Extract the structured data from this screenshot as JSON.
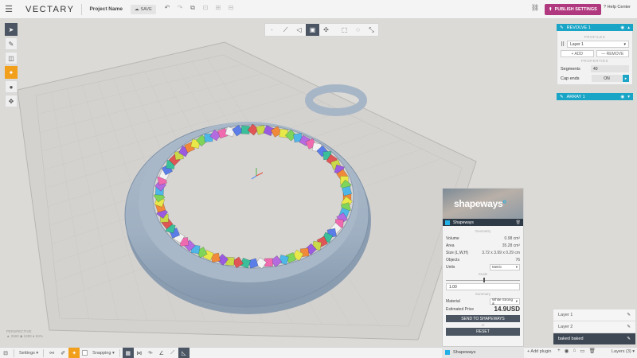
{
  "app": {
    "logo": "VECTARY",
    "project_name": "Project Name",
    "save_label": "SAVE"
  },
  "topbar": {
    "publish_label": "PUBLISH SETTINGS",
    "help_label": "Help Center"
  },
  "revolve_panel": {
    "title": "REVOLVE 1",
    "section_profiles": "PROFILES",
    "layer_value": "Layer 1",
    "add_label": "+ ADD",
    "remove_label": "— REMOVE",
    "section_properties": "PROPERTIES",
    "segments_label": "Segments",
    "segments_value": "40",
    "cap_ends_label": "Cap ends",
    "cap_ends_value": "ON"
  },
  "array_panel": {
    "title": "ARRAY 1"
  },
  "shapeways": {
    "logo": "shapeways",
    "plugin_name": "Shapeways",
    "geometry_label": "Geometry",
    "volume_label": "Volume",
    "volume_value": "0.98 cm²",
    "area_label": "Area",
    "area_value": "35.28 cm²",
    "size_label": "Size (L,W,H)",
    "size_value": "3.72 x 3.99 x 0.29 cm",
    "objects_label": "Objects",
    "objects_value": "76",
    "units_label": "Units",
    "units_value": "Metric",
    "scale_label": "Scale",
    "scale_value": "1.00",
    "summary_label": "Summary",
    "material_label": "Material",
    "material_value": "White Strong &",
    "price_label": "Estimated Price",
    "price_value": "14.9USD",
    "send_label": "SEND TO SHAPEWAYS",
    "or_label": "or",
    "reset_label": "RESET"
  },
  "layers": {
    "items": [
      {
        "label": "Layer 1",
        "selected": false
      },
      {
        "label": "Layer 2",
        "selected": false
      },
      {
        "label": "baked baked",
        "selected": true
      }
    ],
    "layers_button": "Layers (3)"
  },
  "bottombar": {
    "settings_label": "Settings",
    "snapping_label": "Snapping",
    "shapeways_tab": "Shapeways",
    "add_plugin": "+ Add plugin"
  },
  "viewport": {
    "camera_label": "PERSPECTIVE",
    "stats": "▲ 2560  ◆ 1280  ● 84%"
  },
  "colors": {
    "accent": "#1aa4c5",
    "publish": "#b0387e",
    "tool_active": "#f29f1c",
    "dark": "#4b5563"
  }
}
